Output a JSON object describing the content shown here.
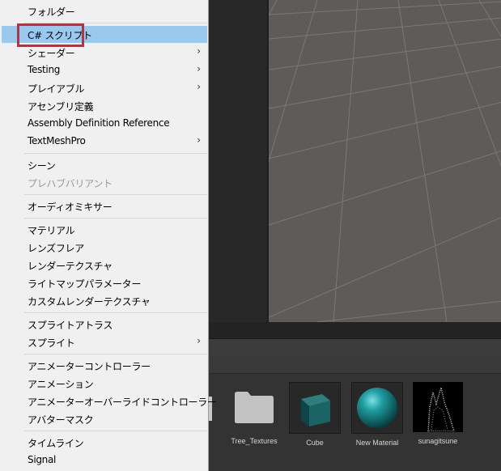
{
  "context_menu": {
    "items": [
      {
        "label": "フォルダー",
        "submenu": false,
        "state": "normal"
      },
      {
        "label": "C# スクリプト",
        "submenu": false,
        "state": "highlighted"
      },
      {
        "label": "シェーダー",
        "submenu": true,
        "state": "normal"
      },
      {
        "label": "Testing",
        "submenu": true,
        "state": "normal"
      },
      {
        "label": "プレイアブル",
        "submenu": true,
        "state": "normal"
      },
      {
        "label": "アセンブリ定義",
        "submenu": false,
        "state": "normal"
      },
      {
        "label": "Assembly Definition Reference",
        "submenu": false,
        "state": "normal"
      },
      {
        "label": "TextMeshPro",
        "submenu": true,
        "state": "normal"
      },
      {
        "label": "シーン",
        "submenu": false,
        "state": "normal"
      },
      {
        "label": "プレハブバリアント",
        "submenu": false,
        "state": "disabled"
      },
      {
        "label": "オーディオミキサー",
        "submenu": false,
        "state": "normal"
      },
      {
        "label": "マテリアル",
        "submenu": false,
        "state": "normal"
      },
      {
        "label": "レンズフレア",
        "submenu": false,
        "state": "normal"
      },
      {
        "label": "レンダーテクスチャ",
        "submenu": false,
        "state": "normal"
      },
      {
        "label": "ライトマップパラメーター",
        "submenu": false,
        "state": "normal"
      },
      {
        "label": "カスタムレンダーテクスチャ",
        "submenu": false,
        "state": "normal"
      },
      {
        "label": "スプライトアトラス",
        "submenu": false,
        "state": "normal"
      },
      {
        "label": "スプライト",
        "submenu": true,
        "state": "normal"
      },
      {
        "label": "アニメーターコントローラー",
        "submenu": false,
        "state": "normal"
      },
      {
        "label": "アニメーション",
        "submenu": false,
        "state": "normal"
      },
      {
        "label": "アニメーターオーバーライドコントローラー",
        "submenu": false,
        "state": "normal"
      },
      {
        "label": "アバターマスク",
        "submenu": false,
        "state": "normal"
      },
      {
        "label": "タイムライン",
        "submenu": false,
        "state": "normal"
      },
      {
        "label": "Signal",
        "submenu": false,
        "state": "normal"
      }
    ],
    "submenu_arrow": "›",
    "highlight_color": "#99c9ef",
    "annotation_color": "#e2202c"
  },
  "project_assets": [
    {
      "name": "Tree_Textures",
      "icon": "folder-icon"
    },
    {
      "name": "Cube",
      "icon": "cube-icon"
    },
    {
      "name": "New Material",
      "icon": "material-sphere-icon"
    },
    {
      "name": "sunagitsune",
      "icon": "texture-thumbnail-icon"
    }
  ]
}
